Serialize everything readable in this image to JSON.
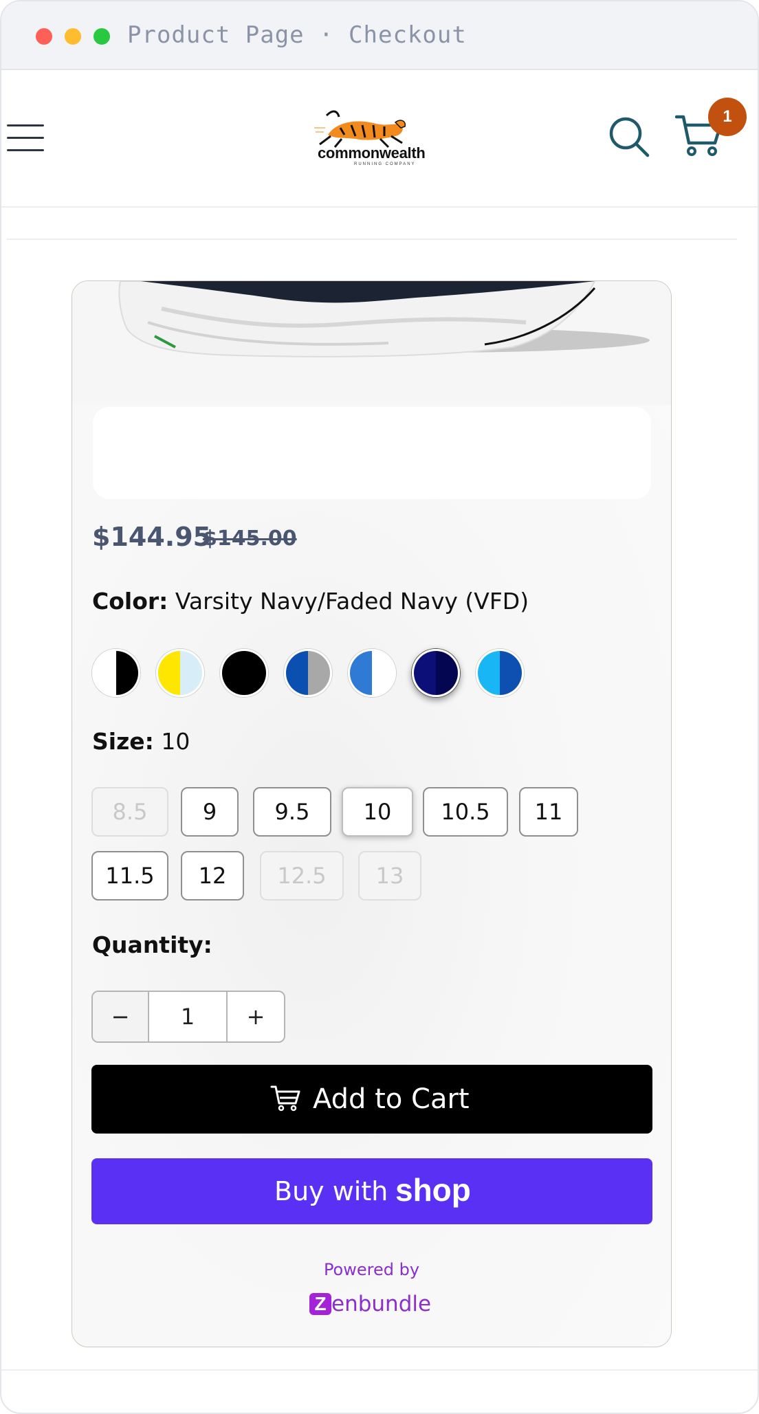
{
  "window": {
    "title": "Product Page · Checkout"
  },
  "header": {
    "logo_text": "commonwealth",
    "logo_subtext": "RUNNING COMPANY",
    "cart_count": "1"
  },
  "product": {
    "price": "$144.95",
    "compare_price": "$145.00",
    "color_label": "Color:",
    "color_value": "Varsity Navy/Faded Navy (VFD)",
    "swatches": [
      {
        "left": "#ffffff",
        "right": "#000000",
        "selected": false
      },
      {
        "left": "#ffe600",
        "right": "#d7eef8",
        "selected": false
      },
      {
        "left": "#000000",
        "right": "#000000",
        "selected": false
      },
      {
        "left": "#0b4fb0",
        "right": "#a8a8a8",
        "selected": false
      },
      {
        "left": "#2f7ad4",
        "right": "#ffffff",
        "selected": false
      },
      {
        "left": "#0d0f78",
        "right": "#050652",
        "selected": true
      },
      {
        "left": "#19b6f5",
        "right": "#0e4fb2",
        "selected": false
      }
    ],
    "size_label": "Size:",
    "size_value": "10",
    "sizes": [
      {
        "label": "8.5",
        "state": "disabled"
      },
      {
        "label": "9",
        "state": "available"
      },
      {
        "label": "9.5",
        "state": "available"
      },
      {
        "label": "10",
        "state": "selected"
      },
      {
        "label": "10.5",
        "state": "available"
      },
      {
        "label": "11",
        "state": "available"
      },
      {
        "label": "11.5",
        "state": "available"
      },
      {
        "label": "12",
        "state": "available"
      },
      {
        "label": "12.5",
        "state": "disabled"
      },
      {
        "label": "13",
        "state": "disabled"
      }
    ],
    "quantity_label": "Quantity:",
    "quantity": {
      "minus": "−",
      "value": "1",
      "plus": "+"
    },
    "add_to_cart_label": "Add to Cart",
    "buy_with_label": "Buy with",
    "shop_label": "shop",
    "powered_by": "Powered by",
    "zenbundle_mark": "Z",
    "zenbundle_word": "enbundle"
  },
  "icons": {
    "menu": "hamburger-icon",
    "search": "search-icon",
    "cart": "cart-icon"
  }
}
